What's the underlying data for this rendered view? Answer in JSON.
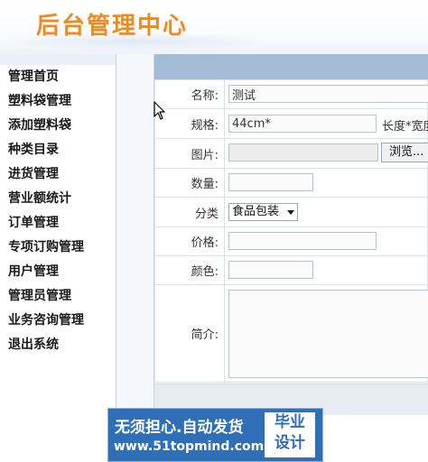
{
  "header": {
    "title": "后台管理中心"
  },
  "sidebar": {
    "items": [
      {
        "label": "管理首页"
      },
      {
        "label": "塑料袋管理"
      },
      {
        "label": "添加塑料袋"
      },
      {
        "label": "种类目录"
      },
      {
        "label": "进货管理"
      },
      {
        "label": "营业额统计"
      },
      {
        "label": "订单管理"
      },
      {
        "label": "专项订购管理"
      },
      {
        "label": "用户管理"
      },
      {
        "label": "管理员管理"
      },
      {
        "label": "业务咨询管理"
      },
      {
        "label": "退出系统"
      }
    ]
  },
  "form": {
    "name": {
      "label": "名称:",
      "value": "测试"
    },
    "spec": {
      "label": "规格:",
      "value": "44cm*",
      "after": "长度*宽度"
    },
    "image": {
      "label": "图片:",
      "browse": "浏览..."
    },
    "quantity": {
      "label": "数量:",
      "value": ""
    },
    "category": {
      "label": "分类",
      "selected": "食品包装"
    },
    "price": {
      "label": "价格:",
      "value": ""
    },
    "color": {
      "label": "颜色:",
      "value": ""
    },
    "intro": {
      "label": "简介:",
      "value": ""
    }
  },
  "banner": {
    "line1": "无须担心.自动发货",
    "line2": "www.51topmind.com",
    "badge_line1": "毕业",
    "badge_line2": "设计"
  }
}
